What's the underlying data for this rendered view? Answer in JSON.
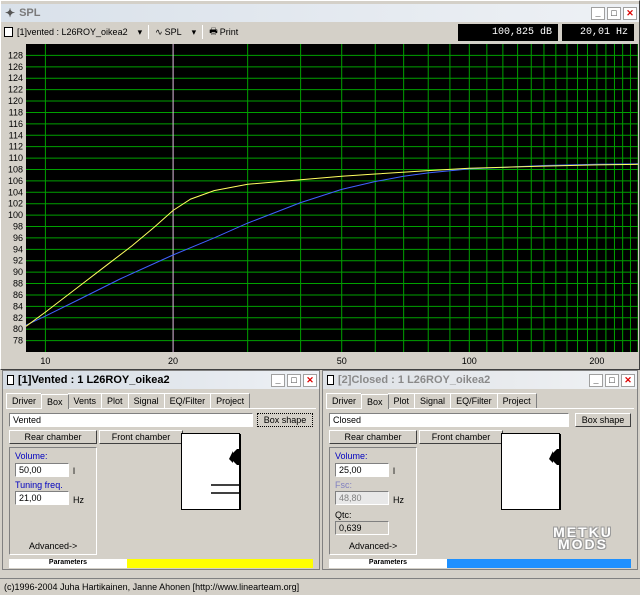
{
  "main_window": {
    "title": "SPL",
    "toolbar": {
      "selector_label": "[1]vented : L26ROY_oikea2",
      "graph_type_label": "SPL",
      "print_label": "Print"
    },
    "readout_db": "100,825 dB",
    "readout_hz": "20,01 Hz"
  },
  "chart_data": {
    "type": "line",
    "x_scale": "log",
    "xlim": [
      9,
      250
    ],
    "ylim": [
      76,
      130
    ],
    "y_ticks": [
      78,
      80,
      82,
      84,
      86,
      88,
      90,
      92,
      94,
      96,
      98,
      100,
      102,
      104,
      106,
      108,
      110,
      112,
      114,
      116,
      118,
      120,
      122,
      124,
      126,
      128
    ],
    "x_tick_labels": [
      {
        "value": 10,
        "label": "10"
      },
      {
        "value": 20,
        "label": "20"
      },
      {
        "value": 50,
        "label": "50"
      },
      {
        "value": 100,
        "label": "100"
      },
      {
        "value": 200,
        "label": "200"
      }
    ],
    "cursor_x": 20.01,
    "grid": true,
    "series": [
      {
        "color": "#ffff60",
        "x": [
          9,
          10,
          12,
          14,
          16,
          18,
          20,
          22,
          25,
          30,
          40,
          50,
          60,
          80,
          100,
          150,
          200,
          250
        ],
        "y": [
          80.5,
          83.0,
          87.5,
          91.3,
          94.6,
          97.8,
          100.8,
          102.8,
          104.3,
          105.4,
          106.2,
          106.8,
          107.2,
          107.8,
          108.2,
          108.6,
          108.8,
          108.9
        ]
      },
      {
        "color": "#4060ff",
        "x": [
          9,
          10,
          12,
          15,
          20,
          25,
          30,
          40,
          50,
          60,
          70,
          80,
          100,
          150,
          200,
          250
        ],
        "y": [
          80.7,
          82.3,
          85.2,
          88.8,
          93.0,
          96.0,
          98.6,
          102.2,
          104.5,
          105.9,
          106.8,
          107.4,
          108.1,
          108.7,
          108.9,
          109.0
        ]
      }
    ]
  },
  "vented_window": {
    "title": "[1]Vented : 1 L26ROY_oikea2",
    "tabs": [
      "Driver",
      "Box",
      "Vents",
      "Plot",
      "Signal",
      "EQ/Filter",
      "Project"
    ],
    "box_type": "Vented",
    "box_shape_btn": "Box shape",
    "rear_chamber_btn": "Rear chamber",
    "front_chamber_btn": "Front chamber",
    "volume_label": "Volume:",
    "volume_value": "50,00",
    "volume_unit": "l",
    "tuning_label": "Tuning freq.",
    "tuning_value": "21,00",
    "tuning_unit": "Hz",
    "advanced_btn": "Advanced->",
    "params_label": "Parameters",
    "color": "#ffff00"
  },
  "closed_window": {
    "title": "[2]Closed : 1 L26ROY_oikea2",
    "tabs": [
      "Driver",
      "Box",
      "Plot",
      "Signal",
      "EQ/Filter",
      "Project"
    ],
    "box_type": "Closed",
    "box_shape_btn": "Box shape",
    "rear_chamber_btn": "Rear chamber",
    "front_chamber_btn": "Front chamber",
    "volume_label": "Volume:",
    "volume_value": "25,00",
    "volume_unit": "l",
    "fsc_label": "Fsc:",
    "fsc_value": "48,80",
    "fsc_unit": "Hz",
    "qtc_label": "Qtc:",
    "qtc_value": "0,639",
    "advanced_btn": "Advanced->",
    "params_label": "Parameters",
    "color": "#1e90ff"
  },
  "watermark": {
    "line1": "METKU",
    "line2": "MODS"
  },
  "statusbar": {
    "text": "(c)1996-2004 Juha Hartikainen, Janne Ahonen [http://www.linearteam.org]"
  }
}
